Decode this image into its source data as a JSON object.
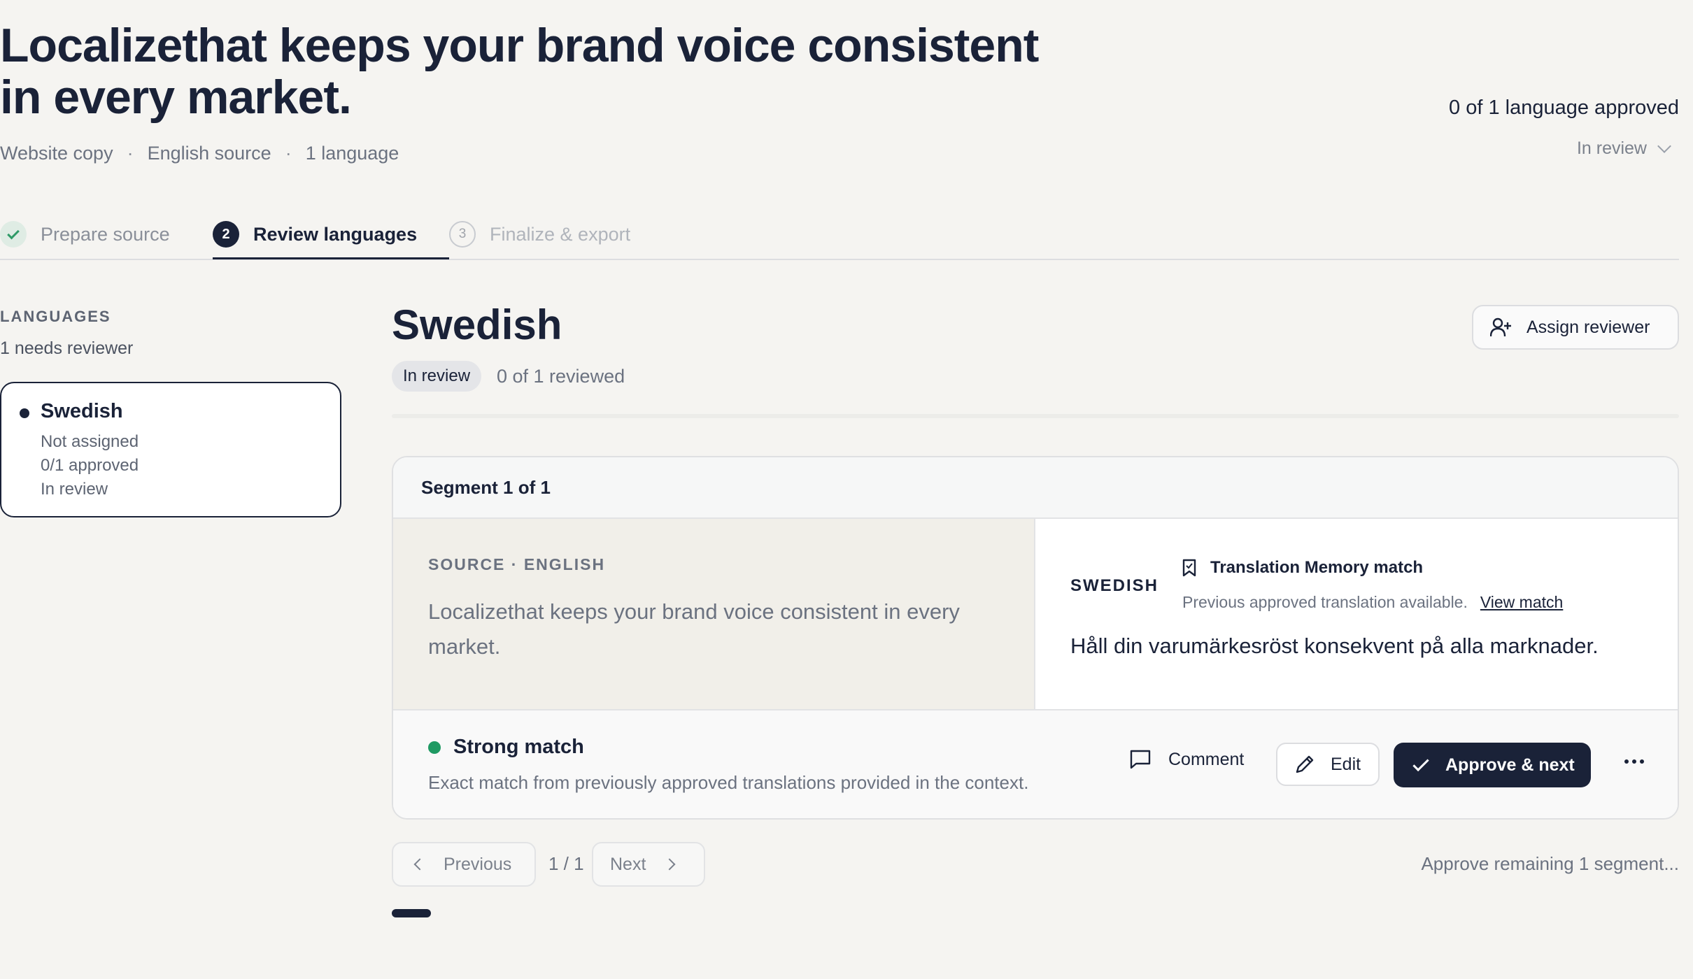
{
  "header": {
    "title": "Localizethat keeps your brand voice consistent in every market.",
    "meta": [
      "Website copy",
      "English source",
      "1 language"
    ],
    "meta_separator": "·",
    "approved_summary": "0 of 1 language approved",
    "status_select": "In review"
  },
  "stepper": {
    "steps": [
      {
        "number": "",
        "label": "Prepare source",
        "state": "done"
      },
      {
        "number": "2",
        "label": "Review languages",
        "state": "active"
      },
      {
        "number": "3",
        "label": "Finalize & export",
        "state": "upcoming"
      }
    ]
  },
  "sidebar": {
    "heading": "LANGUAGES",
    "subheading": "1 needs reviewer",
    "languages": [
      {
        "name": "Swedish",
        "assignee": "Not assigned",
        "progress": "0/1 approved",
        "status": "In review"
      }
    ]
  },
  "main": {
    "language": "Swedish",
    "badge": "In review",
    "reviewed": "0 of 1 reviewed",
    "assign_label": "Assign reviewer"
  },
  "segment": {
    "title": "Segment 1 of 1",
    "source_label": "SOURCE · ENGLISH",
    "source_text": "Localizethat keeps your brand voice consistent in every market.",
    "target_label": "SWEDISH",
    "tm_title": "Translation Memory match",
    "tm_desc": "Previous approved translation available.",
    "tm_link": "View match",
    "target_text": "Håll din varumärkesröst konsekvent på alla marknader.",
    "match_title": "Strong match",
    "match_desc": "Exact match from previously approved translations provided in the context.",
    "comment_label": "Comment",
    "edit_label": "Edit",
    "approve_label": "Approve & next"
  },
  "pagination": {
    "prev_label": "Previous",
    "indicator": "1 / 1",
    "next_label": "Next",
    "approve_remaining": "Approve remaining 1 segment..."
  },
  "colors": {
    "primary": "#1a2238",
    "background": "#f5f4f1",
    "success": "#1f9a63",
    "muted": "#6b7280"
  }
}
